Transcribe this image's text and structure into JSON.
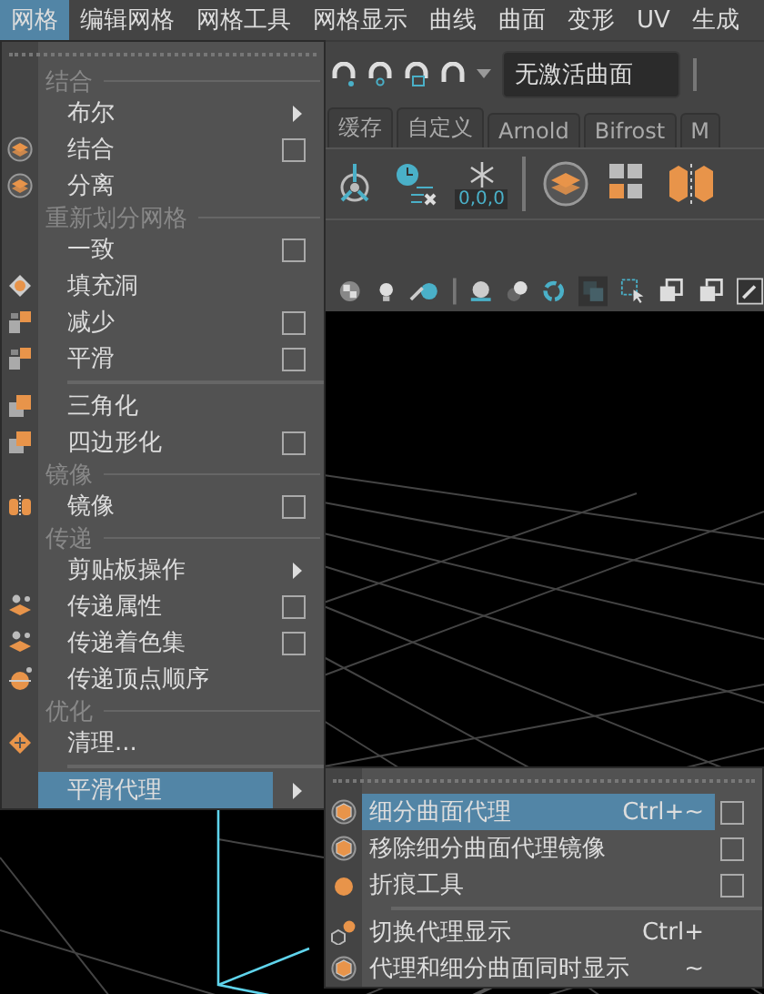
{
  "menubar": [
    {
      "label": "网格",
      "selected": true
    },
    {
      "label": "编辑网格",
      "selected": false
    },
    {
      "label": "网格工具",
      "selected": false
    },
    {
      "label": "网格显示",
      "selected": false
    },
    {
      "label": "曲线",
      "selected": false
    },
    {
      "label": "曲面",
      "selected": false
    },
    {
      "label": "变形",
      "selected": false
    },
    {
      "label": "UV",
      "selected": false
    },
    {
      "label": "生成",
      "selected": false
    }
  ],
  "status_line": {
    "surface_field": {
      "value": "无激活曲面"
    }
  },
  "shelf_tabs": [
    {
      "label": "缓存",
      "selected": false
    },
    {
      "label": "自定义",
      "selected": false
    },
    {
      "label": "Arnold",
      "selected": false
    },
    {
      "label": "Bifrost",
      "selected": false
    },
    {
      "label": "M",
      "selected": false
    }
  ],
  "shelf": {
    "snowflake_label": "0,0,0"
  },
  "mesh_menu": [
    {
      "kind": "header",
      "label": "结合"
    },
    {
      "kind": "item",
      "label": "布尔",
      "submenu": true,
      "option_box": false,
      "selected": false
    },
    {
      "kind": "item",
      "label": "结合",
      "submenu": false,
      "option_box": true,
      "selected": false
    },
    {
      "kind": "item",
      "label": "分离",
      "submenu": false,
      "option_box": false,
      "selected": false
    },
    {
      "kind": "header",
      "label": "重新划分网格"
    },
    {
      "kind": "item",
      "label": "一致",
      "submenu": false,
      "option_box": true,
      "selected": false
    },
    {
      "kind": "item",
      "label": "填充洞",
      "submenu": false,
      "option_box": false,
      "selected": false
    },
    {
      "kind": "item",
      "label": "减少",
      "submenu": false,
      "option_box": true,
      "selected": false
    },
    {
      "kind": "item",
      "label": "平滑",
      "submenu": false,
      "option_box": true,
      "selected": false
    },
    {
      "kind": "separator"
    },
    {
      "kind": "item",
      "label": "三角化",
      "submenu": false,
      "option_box": false,
      "selected": false
    },
    {
      "kind": "item",
      "label": "四边形化",
      "submenu": false,
      "option_box": true,
      "selected": false
    },
    {
      "kind": "header",
      "label": "镜像"
    },
    {
      "kind": "item",
      "label": "镜像",
      "submenu": false,
      "option_box": true,
      "selected": false
    },
    {
      "kind": "header",
      "label": "传递"
    },
    {
      "kind": "item",
      "label": "剪贴板操作",
      "submenu": true,
      "option_box": false,
      "selected": false
    },
    {
      "kind": "item",
      "label": "传递属性",
      "submenu": false,
      "option_box": true,
      "selected": false
    },
    {
      "kind": "item",
      "label": "传递着色集",
      "submenu": false,
      "option_box": true,
      "selected": false
    },
    {
      "kind": "item",
      "label": "传递顶点顺序",
      "submenu": false,
      "option_box": false,
      "selected": false
    },
    {
      "kind": "header",
      "label": "优化"
    },
    {
      "kind": "item",
      "label": "清理...",
      "submenu": false,
      "option_box": false,
      "selected": false
    },
    {
      "kind": "separator"
    },
    {
      "kind": "item",
      "label": "平滑代理",
      "submenu": true,
      "option_box": false,
      "selected": true
    }
  ],
  "smooth_proxy_menu": [
    {
      "kind": "item",
      "label": "细分曲面代理",
      "shortcut": "Ctrl+~",
      "submenu": false,
      "option_box": true,
      "selected": true
    },
    {
      "kind": "item",
      "label": "移除细分曲面代理镜像",
      "submenu": false,
      "option_box": true,
      "selected": false
    },
    {
      "kind": "item",
      "label": "折痕工具",
      "submenu": false,
      "option_box": true,
      "selected": false
    },
    {
      "kind": "separator"
    },
    {
      "kind": "item",
      "label": "切换代理显示",
      "shortcut": "Ctrl+",
      "submenu": false,
      "option_box": false,
      "selected": false
    },
    {
      "kind": "item",
      "label": "代理和细分曲面同时显示",
      "shortcut": "~",
      "submenu": false,
      "option_box": false,
      "selected": false
    }
  ]
}
